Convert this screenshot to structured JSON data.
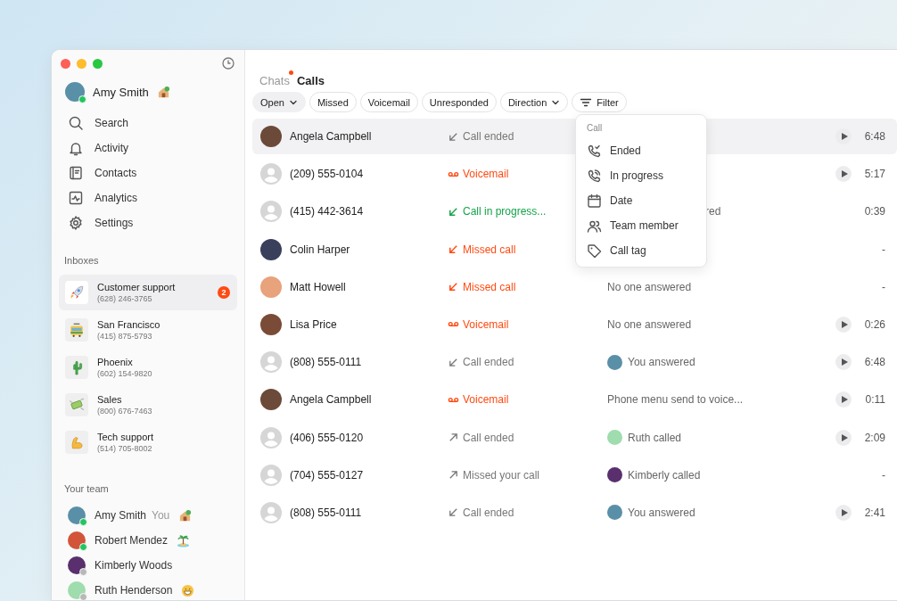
{
  "user": {
    "name": "Amy Smith",
    "online": true
  },
  "nav": [
    {
      "label": "Search"
    },
    {
      "label": "Activity"
    },
    {
      "label": "Contacts"
    },
    {
      "label": "Analytics"
    },
    {
      "label": "Settings"
    }
  ],
  "inboxes_heading": "Inboxes",
  "inboxes": [
    {
      "name": "Customer support",
      "phone": "(628) 246-3765",
      "kind": "rocket",
      "selected": true,
      "badge": "2"
    },
    {
      "name": "San Francisco",
      "phone": "(415) 875-5793",
      "kind": "tram",
      "selected": false
    },
    {
      "name": "Phoenix",
      "phone": "(602) 154-9820",
      "kind": "cactus",
      "selected": false
    },
    {
      "name": "Sales",
      "phone": "(800) 676-7463",
      "kind": "money",
      "selected": false
    },
    {
      "name": "Tech support",
      "phone": "(514) 705-8002",
      "kind": "arm",
      "selected": false
    }
  ],
  "team_heading": "Your team",
  "team": [
    {
      "name": "Amy Smith",
      "you": "You",
      "online": true
    },
    {
      "name": "Robert Mendez",
      "online": true
    },
    {
      "name": "Kimberly Woods",
      "online": false
    },
    {
      "name": "Ruth Henderson",
      "online": false
    }
  ],
  "tabs": [
    {
      "label": "Chats",
      "selected": false,
      "unread": true
    },
    {
      "label": "Calls",
      "selected": true,
      "unread": false
    }
  ],
  "chips": [
    {
      "label": "Open",
      "selected": true,
      "dropdown": true,
      "kind": "plain"
    },
    {
      "label": "Missed",
      "selected": false,
      "kind": "plain"
    },
    {
      "label": "Voicemail",
      "selected": false,
      "kind": "plain"
    },
    {
      "label": "Unresponded",
      "selected": false,
      "kind": "plain"
    },
    {
      "label": "Direction",
      "selected": false,
      "dropdown": true,
      "kind": "plain"
    },
    {
      "label": "Filter",
      "selected": false,
      "kind": "filter"
    }
  ],
  "calls": [
    {
      "name": "Angela Campbell",
      "photo": true,
      "status": "Call ended",
      "kind": "ended-in",
      "selected": true,
      "duration": "6:48",
      "recording": true
    },
    {
      "name": "(209) 555-0104",
      "photo": false,
      "status": "Voicemail",
      "kind": "voicemail",
      "selected": false,
      "duration": "5:17",
      "recording": true
    },
    {
      "name": "(415) 442-3614",
      "photo": false,
      "status": "Call in progress...",
      "kind": "in-progress",
      "selected": false,
      "detail": "red",
      "detail_covered": true,
      "duration": "0:39",
      "recording": false
    },
    {
      "name": "Colin Harper",
      "photo": true,
      "status": "Missed call",
      "kind": "missed",
      "selected": false,
      "duration": "-",
      "recording": false
    },
    {
      "name": "Matt Howell",
      "photo": true,
      "status": "Missed call",
      "kind": "missed",
      "selected": false,
      "detail": "No one answered",
      "duration": "-",
      "recording": false
    },
    {
      "name": "Lisa Price",
      "photo": true,
      "status": "Voicemail",
      "kind": "voicemail",
      "selected": false,
      "detail": "No one answered",
      "duration": "0:26",
      "recording": true
    },
    {
      "name": "(808) 555-0111",
      "photo": false,
      "status": "Call ended",
      "kind": "ended-in",
      "selected": false,
      "detail": "You answered",
      "detail_avatar": true,
      "duration": "6:48",
      "recording": true
    },
    {
      "name": "Angela Campbell",
      "photo": true,
      "status": "Voicemail",
      "kind": "voicemail",
      "selected": false,
      "detail": "Phone menu send to voice...",
      "duration": "0:11",
      "recording": true
    },
    {
      "name": "(406) 555-0120",
      "photo": false,
      "status": "Call ended",
      "kind": "outgoing",
      "selected": false,
      "detail": "Ruth called",
      "detail_avatar": true,
      "duration": "2:09",
      "recording": true
    },
    {
      "name": "(704) 555-0127",
      "photo": false,
      "status": "Missed your call",
      "kind": "outgoing",
      "selected": false,
      "detail": "Kimberly called",
      "detail_avatar": true,
      "duration": "-",
      "recording": false
    },
    {
      "name": "(808) 555-0111",
      "photo": false,
      "status": "Call ended",
      "kind": "ended-in",
      "selected": false,
      "detail": "You answered",
      "detail_avatar": true,
      "duration": "2:41",
      "recording": true
    }
  ],
  "menu": {
    "heading": "Call",
    "items": [
      {
        "label": "Ended"
      },
      {
        "label": "In progress"
      },
      {
        "label": "Date"
      },
      {
        "label": "Team member"
      },
      {
        "label": "Call tag"
      }
    ]
  }
}
